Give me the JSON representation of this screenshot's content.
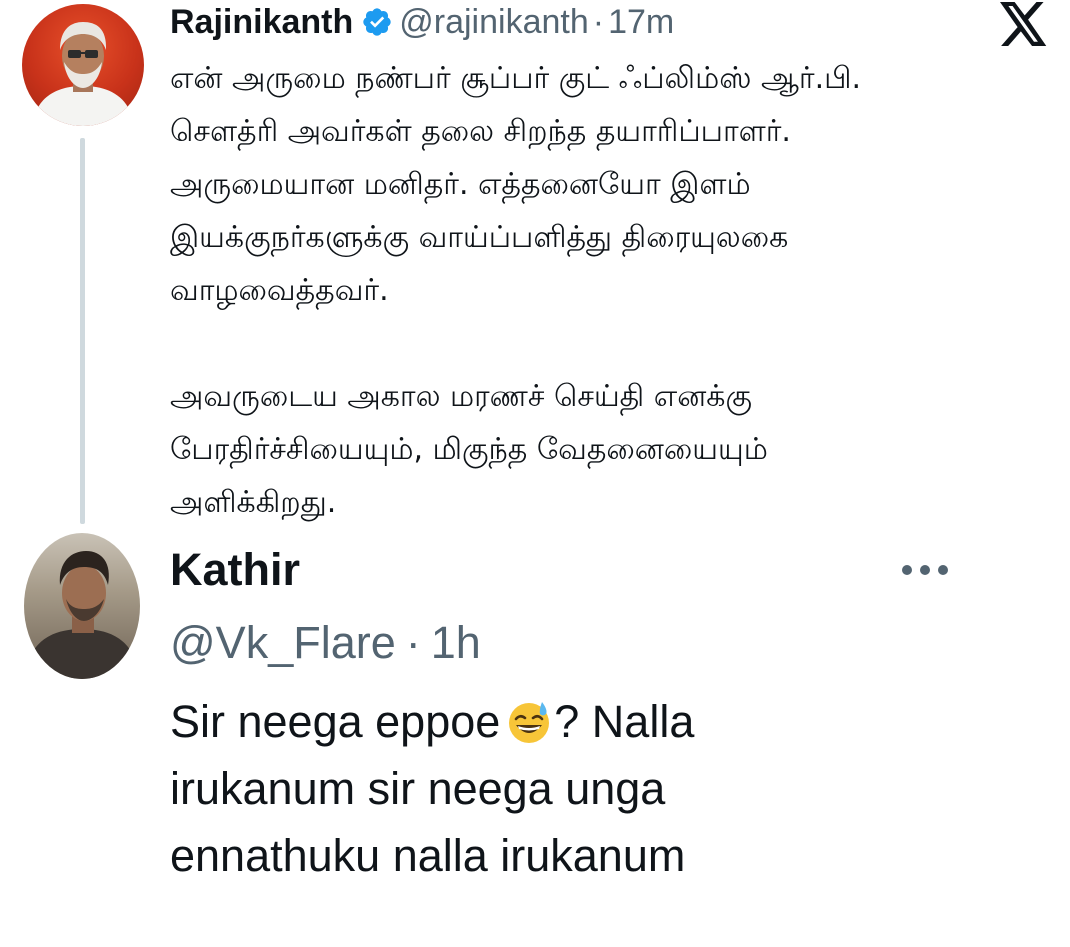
{
  "tweet_1": {
    "author_name": "Rajinikanth",
    "handle": "@rajinikanth",
    "separator": "·",
    "time": "17m",
    "verified": true,
    "avatar_icon": "profile-photo",
    "platform_icon": "x-logo",
    "paragraph_1": "என் அருமை நண்பர் சூப்பர் குட் ஃப்லிம்ஸ் ஆர்.பி.\nசௌத்ரி அவர்கள் தலை சிறந்த தயாரிப்பாளர்.\nஅருமையான மனிதர்.  எத்தனையோ இளம்\nஇயக்குநர்களுக்கு வாய்ப்பளித்து திரையுலகை\nவாழவைத்தவர்.",
    "paragraph_2": "அவருடைய அகால மரணச் செய்தி எனக்கு\nபேரதிர்ச்சியையும், மிகுந்த வேதனையையும்\nஅளிக்கிறது."
  },
  "tweet_2": {
    "author_name": "Kathir",
    "handle": "@Vk_Flare",
    "separator": "·",
    "time": "1h",
    "avatar_icon": "profile-photo",
    "more_icon": "more-horizontal-icon",
    "text_part_1": "Sir neega eppoe",
    "emoji": "grinning-face-with-sweat-emoji",
    "text_part_2": "? Nalla",
    "line_2": "irukanum sir neega unga",
    "line_3": "ennathuku nalla irukanum"
  },
  "colors": {
    "text_primary": "#0f1419",
    "text_secondary": "#536471",
    "verified_blue": "#1d9bf0",
    "thread_line": "#cfd9de",
    "background": "#ffffff"
  }
}
